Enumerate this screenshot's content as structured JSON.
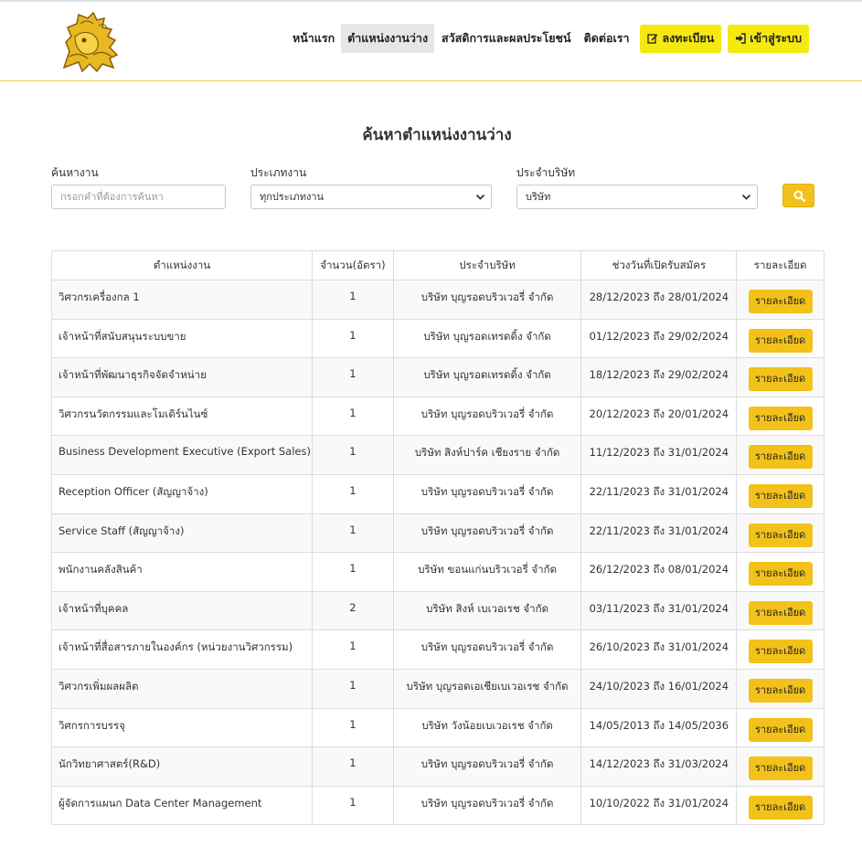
{
  "nav": {
    "home": "หน้าแรก",
    "jobs": "ตำแหน่งงานว่าง",
    "welfare": "สวัสดิการและผลประโยชน์",
    "contact": "ติดต่อเรา",
    "register": "ลงทะเบียน",
    "login": "เข้าสู่ระบบ"
  },
  "search": {
    "title": "ค้นหาตำแหน่งงานว่าง",
    "keyword_label": "ค้นหางาน",
    "keyword_placeholder": "กรอกคำที่ต้องการค้นหา",
    "type_label": "ประเภทงาน",
    "type_value": "ทุกประเภทงาน",
    "company_label": "ประจำบริษัท",
    "company_value": "บริษัท"
  },
  "colors": {
    "accent": "#f2c21a",
    "nav_button": "#f5e90f",
    "divider": "#f2c94c"
  },
  "table": {
    "headers": [
      "ตำแหน่งงาน",
      "จำนวน(อัตรา)",
      "ประจำบริษัท",
      "ช่วงวันที่เปิดรับสมัคร",
      "รายละเอียด"
    ],
    "detail_label": "รายละเอียด",
    "rows": [
      {
        "title": "วิศวกรเครื่องกล 1",
        "count": "1",
        "company": "บริษัท บุญรอดบริวเวอรี่ จำกัด",
        "period": "28/12/2023 ถึง 28/01/2024"
      },
      {
        "title": "เจ้าหน้าที่สนับสนุนระบบขาย",
        "count": "1",
        "company": "บริษัท บุญรอดเทรดดิ้ง จำกัด",
        "period": "01/12/2023 ถึง 29/02/2024"
      },
      {
        "title": "เจ้าหน้าที่พัฒนาธุรกิจจัดจำหน่าย",
        "count": "1",
        "company": "บริษัท บุญรอดเทรดดิ้ง จำกัด",
        "period": "18/12/2023 ถึง 29/02/2024"
      },
      {
        "title": "วิศวกรนวัตกรรมและโมเดิร์นไนซ์",
        "count": "1",
        "company": "บริษัท บุญรอดบริวเวอรี่ จำกัด",
        "period": "20/12/2023 ถึง 20/01/2024"
      },
      {
        "title": "Business Development Executive (Export Sales)",
        "count": "1",
        "company": "บริษัท สิงห์ปาร์ค เชียงราย จำกัด",
        "period": "11/12/2023 ถึง 31/01/2024"
      },
      {
        "title": "Reception Officer (สัญญาจ้าง)",
        "count": "1",
        "company": "บริษัท บุญรอดบริวเวอรี่ จำกัด",
        "period": "22/11/2023 ถึง 31/01/2024"
      },
      {
        "title": "Service Staff (สัญญาจ้าง)",
        "count": "1",
        "company": "บริษัท บุญรอดบริวเวอรี่ จำกัด",
        "period": "22/11/2023 ถึง 31/01/2024"
      },
      {
        "title": "พนักงานคลังสินค้า",
        "count": "1",
        "company": "บริษัท ขอนแก่นบริวเวอรี่ จำกัด",
        "period": "26/12/2023 ถึง 08/01/2024"
      },
      {
        "title": "เจ้าหน้าที่บุคคล",
        "count": "2",
        "company": "บริษัท สิงห์ เบเวอเรช จำกัด",
        "period": "03/11/2023 ถึง 31/01/2024"
      },
      {
        "title": "เจ้าหน้าที่สื่อสารภายในองค์กร (หน่วยงานวิศวกรรม)",
        "count": "1",
        "company": "บริษัท บุญรอดบริวเวอรี่ จำกัด",
        "period": "26/10/2023 ถึง 31/01/2024"
      },
      {
        "title": "วิศวกรเพิ่มผลผลิต",
        "count": "1",
        "company": "บริษัท บุญรอดเอเชียเบเวอเรช จำกัด",
        "period": "24/10/2023 ถึง 16/01/2024"
      },
      {
        "title": "วิศกรการบรรจุ",
        "count": "1",
        "company": "บริษัท วังน้อยเบเวอเรช จำกัด",
        "period": "14/05/2013 ถึง 14/05/2036"
      },
      {
        "title": "นักวิทยาศาสตร์(R&D)",
        "count": "1",
        "company": "บริษัท บุญรอดบริวเวอรี่ จำกัด",
        "period": "14/12/2023 ถึง 31/03/2024"
      },
      {
        "title": "ผู้จัดการแผนก Data Center Management",
        "count": "1",
        "company": "บริษัท บุญรอดบริวเวอรี่ จำกัด",
        "period": "10/10/2022 ถึง 31/01/2024"
      }
    ]
  }
}
